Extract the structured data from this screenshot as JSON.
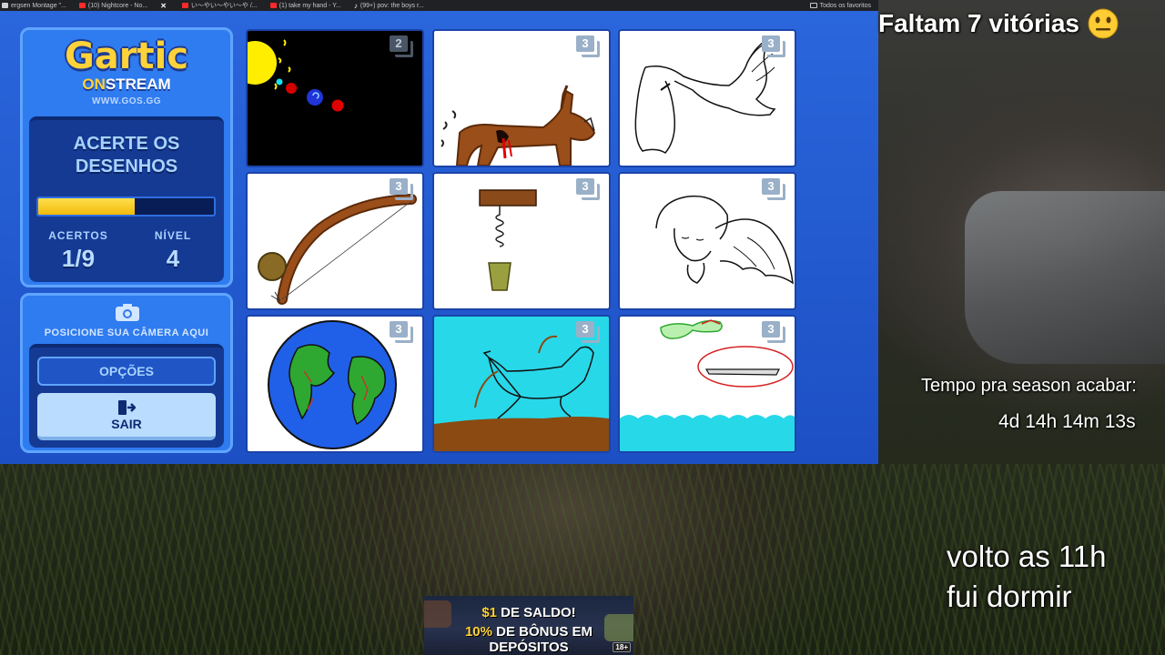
{
  "browser": {
    "bookmarks": [
      {
        "label": "ergsen Montage \"...",
        "icon_color": "#d0d0d0"
      },
      {
        "label": "(10) Nightcore - No...",
        "icon_color": "#ff2a2a"
      },
      {
        "label": "",
        "icon_color": "#ffffff"
      },
      {
        "label": "い〜やい〜やい〜や /...",
        "icon_color": "#ff2a2a"
      },
      {
        "label": "(1) take my hand - Y...",
        "icon_color": "#ff2a2a"
      },
      {
        "label": "(99+) pov: the boys r...",
        "icon_color": "#ffffff"
      }
    ],
    "all_bookmarks": "Todos os favoritos"
  },
  "game": {
    "logo": {
      "title": "Gartic",
      "on": "ON",
      "stream": "STREAM",
      "url": "WWW.GOS.GG"
    },
    "mode_title": "ACERTE OS DESENHOS",
    "progress_fraction": 0.55,
    "hits_label": "ACERTOS",
    "hits_value": "1/9",
    "level_label": "NÍVEL",
    "level_value": "4",
    "camera_text": "POSICIONE SUA CÂMERA AQUI",
    "options_label": "OPÇÕES",
    "exit_label": "SAIR",
    "drawings": [
      {
        "badge": "2",
        "theme": "dark",
        "subject": "solar-system"
      },
      {
        "badge": "3",
        "theme": "light",
        "subject": "wounded-animal"
      },
      {
        "badge": "3",
        "theme": "light",
        "subject": "swan-flying"
      },
      {
        "badge": "3",
        "theme": "light",
        "subject": "bow"
      },
      {
        "badge": "3",
        "theme": "light",
        "subject": "corkscrew"
      },
      {
        "badge": "3",
        "theme": "light",
        "subject": "angel"
      },
      {
        "badge": "3",
        "theme": "light",
        "subject": "globe"
      },
      {
        "badge": "3",
        "theme": "light",
        "subject": "dog-jumping"
      },
      {
        "badge": "3",
        "theme": "light",
        "subject": "surfboard-sea"
      }
    ],
    "colors": {
      "accent_blue": "#2a66dc",
      "progress_yellow": "#ffd23a"
    }
  },
  "overlay": {
    "wins_text": "Faltam 7 vitórias",
    "wins_emoji": "neutral-face-emoji",
    "season_label": "Tempo pra season acabar:",
    "season_time": "4d 14h 14m 13s",
    "away_line1": "volto as 11h",
    "away_line2": "fui dormir"
  },
  "ad": {
    "line1_amount": "$1",
    "line1_rest": " DE SALDO!",
    "line2_percent": "10%",
    "line2_rest": " DE BÔNUS EM DEPÓSITOS",
    "age": "18+"
  }
}
